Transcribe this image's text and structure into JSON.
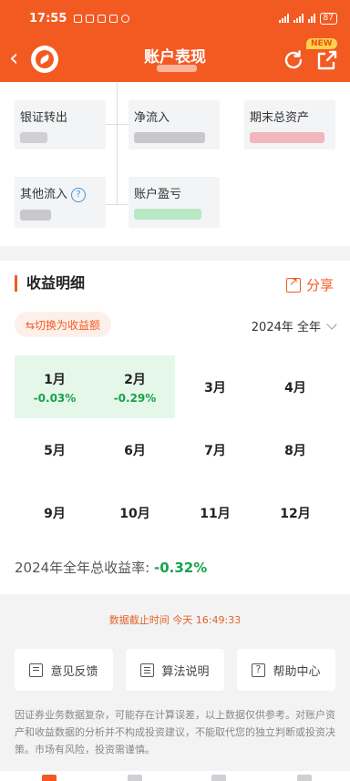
{
  "status_bar": {
    "time": "17:55",
    "battery": "87"
  },
  "header": {
    "title": "账户表现",
    "new_badge": "NEW"
  },
  "flow": {
    "bank_transfer_out_label": "银证转出",
    "net_inflow_label": "净流入",
    "ending_total_assets_label": "期末总资产",
    "other_inflow_label": "其他流入",
    "account_pnl_label": "账户盈亏"
  },
  "detail": {
    "section_title": "收益明细",
    "share_label": "分享",
    "toggle_label": "⇆切换为收益额",
    "period_label": "2024年 全年",
    "months": [
      {
        "name": "1月",
        "return": "-0.03%"
      },
      {
        "name": "2月",
        "return": "-0.29%"
      },
      {
        "name": "3月",
        "return": ""
      },
      {
        "name": "4月",
        "return": ""
      },
      {
        "name": "5月",
        "return": ""
      },
      {
        "name": "6月",
        "return": ""
      },
      {
        "name": "7月",
        "return": ""
      },
      {
        "name": "8月",
        "return": ""
      },
      {
        "name": "9月",
        "return": ""
      },
      {
        "name": "10月",
        "return": ""
      },
      {
        "name": "11月",
        "return": ""
      },
      {
        "name": "12月",
        "return": ""
      }
    ],
    "total_label": "2024年全年总收益率: ",
    "total_value": "-0.32%"
  },
  "cutoff_time": "数据截止时间 今天 16:49:33",
  "actions": {
    "feedback": "意见反馈",
    "algorithm": "算法说明",
    "help_center": "帮助中心"
  },
  "disclaimer": "因证券业务数据复杂，可能存在计算误差，以上数据仅供参考。对账户资产和收益数据的分析并不构成投资建议，不能取代您的独立判断或投资决策。市场有风险，投资需谨慎。",
  "colors": {
    "brand": "#f35a22",
    "positive_bg": "#e5f7e9",
    "negative_green": "#16a34a"
  }
}
